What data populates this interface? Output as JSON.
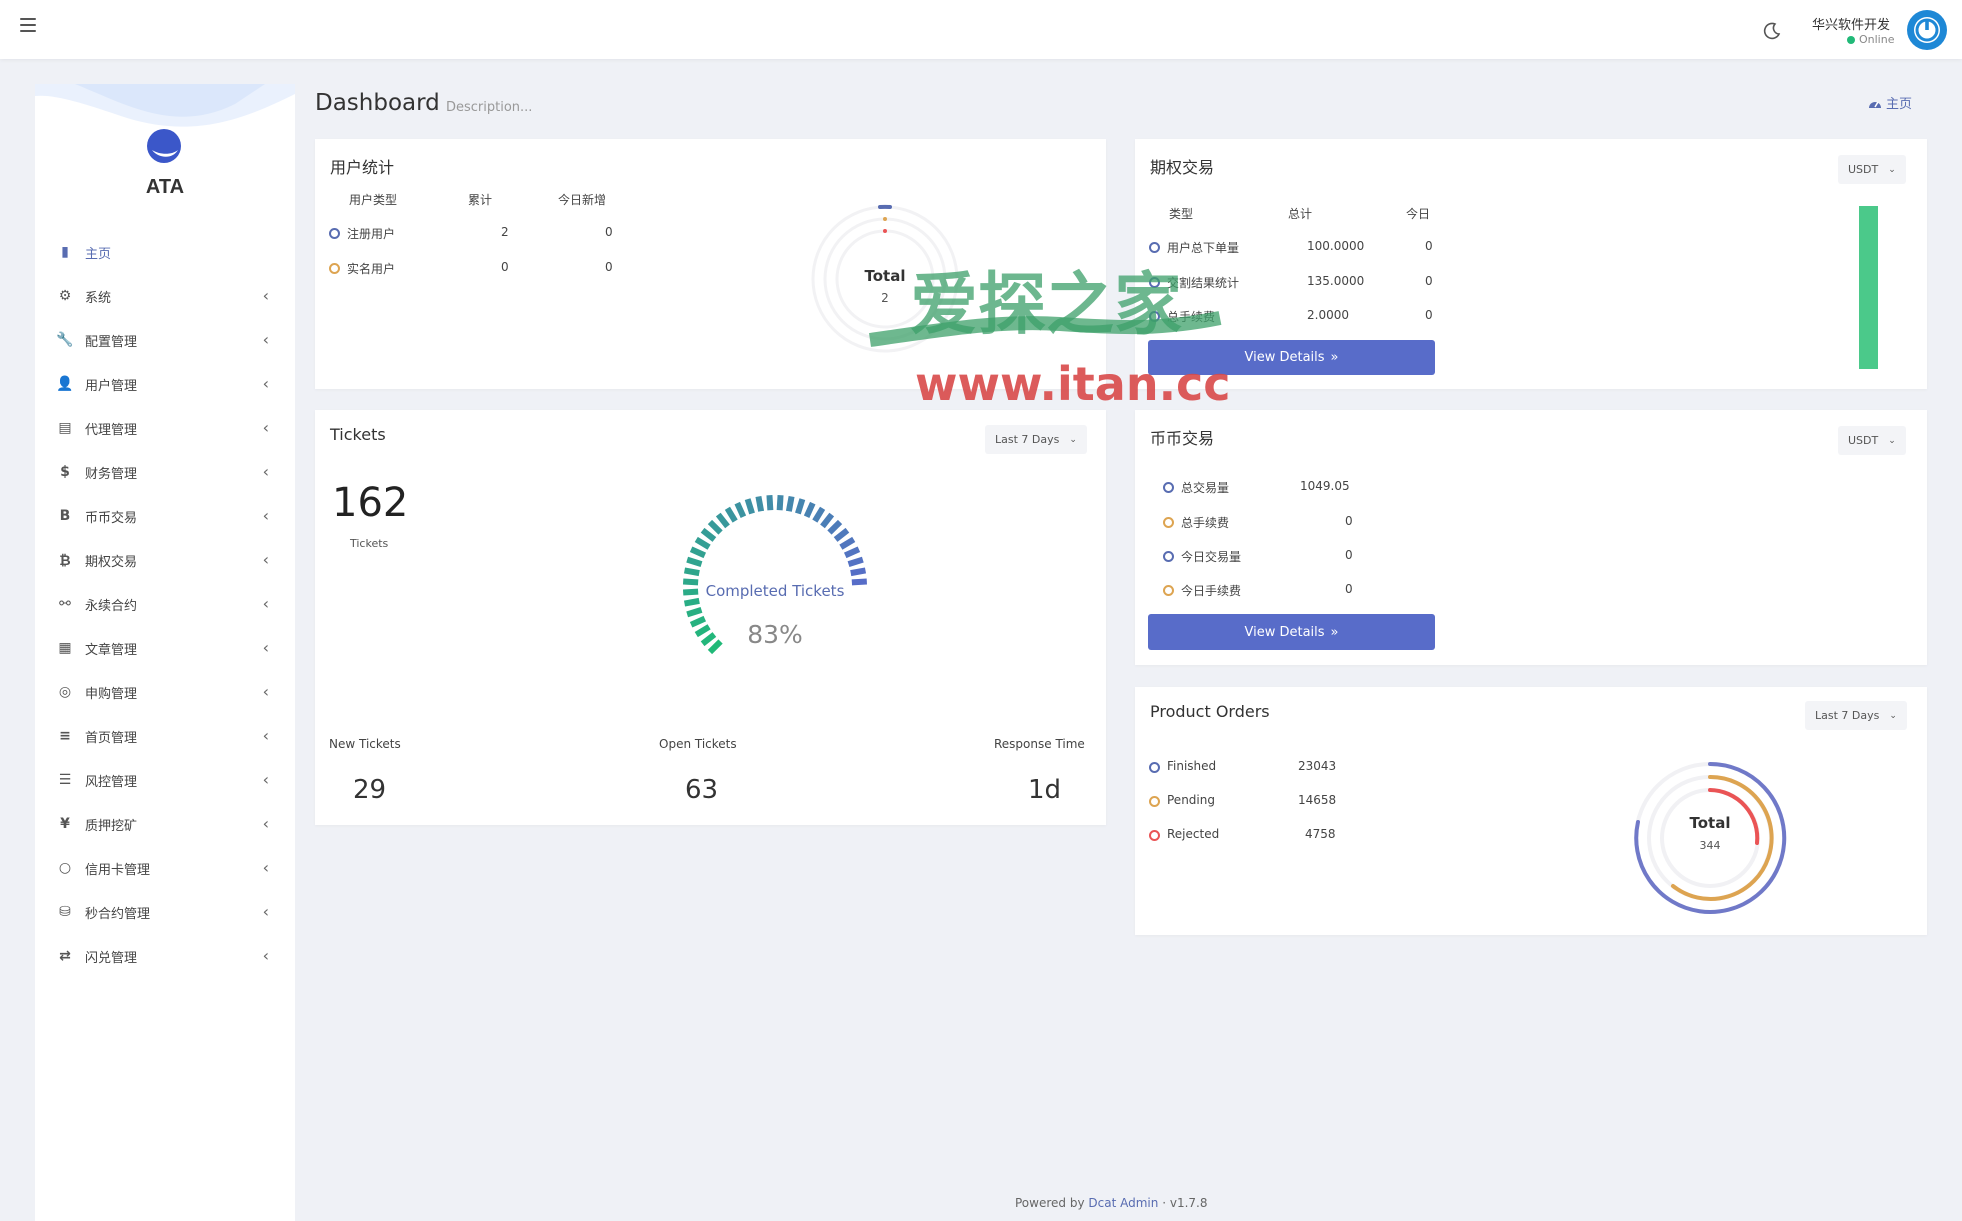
{
  "topbar": {
    "user_name": "华兴软件开发",
    "user_status": "Online"
  },
  "sidebar": {
    "brand": "ATA",
    "items": [
      {
        "label": "主页",
        "icon": "bar-chart-icon",
        "active": true,
        "has_children": false
      },
      {
        "label": "系统",
        "icon": "gear-icon",
        "has_children": true
      },
      {
        "label": "配置管理",
        "icon": "wrench-icon",
        "has_children": true
      },
      {
        "label": "用户管理",
        "icon": "users-icon",
        "has_children": true
      },
      {
        "label": "代理管理",
        "icon": "id-card-icon",
        "has_children": true
      },
      {
        "label": "财务管理",
        "icon": "dollar-icon",
        "has_children": true
      },
      {
        "label": "币币交易",
        "icon": "bitcoin-b-icon",
        "has_children": true
      },
      {
        "label": "期权交易",
        "icon": "bitcoin-icon",
        "has_children": true
      },
      {
        "label": "永续合约",
        "icon": "link-icon",
        "has_children": true
      },
      {
        "label": "文章管理",
        "icon": "newspaper-icon",
        "has_children": true
      },
      {
        "label": "申购管理",
        "icon": "life-ring-icon",
        "has_children": true
      },
      {
        "label": "首页管理",
        "icon": "list-icon",
        "has_children": true
      },
      {
        "label": "风控管理",
        "icon": "list-alt-icon",
        "has_children": true
      },
      {
        "label": "质押挖矿",
        "icon": "yen-icon",
        "has_children": true
      },
      {
        "label": "信用卡管理",
        "icon": "circle-icon",
        "has_children": true
      },
      {
        "label": "秒合约管理",
        "icon": "coins-icon",
        "has_children": true
      },
      {
        "label": "闪兑管理",
        "icon": "exchange-icon",
        "has_children": true
      }
    ]
  },
  "page": {
    "title": "Dashboard",
    "description": "Description...",
    "breadcrumb": "主页"
  },
  "user_stats": {
    "title": "用户统计",
    "headers": [
      "用户类型",
      "累计",
      "今日新增"
    ],
    "rows": [
      {
        "label": "注册用户",
        "total": "2",
        "today": "0",
        "color": "#586cb1"
      },
      {
        "label": "实名用户",
        "total": "0",
        "today": "0",
        "color": "#dda451"
      }
    ],
    "chart_label": "Total",
    "chart_value": "2"
  },
  "options": {
    "title": "期权交易",
    "currency": "USDT",
    "headers": [
      "类型",
      "总计",
      "今日"
    ],
    "rows": [
      {
        "label": "用户总下单量",
        "total": "100.0000",
        "today": "0"
      },
      {
        "label": "交割结果统计",
        "total": "135.0000",
        "today": "0"
      },
      {
        "label": "总手续费",
        "total": "2.0000",
        "today": "0"
      }
    ],
    "button": "View Details",
    "bar_color": "#4bc98a"
  },
  "tickets": {
    "title": "Tickets",
    "range": "Last 7 Days",
    "total": "162",
    "total_label": "Tickets",
    "gauge_label": "Completed Tickets",
    "gauge_value": "83%",
    "completed_percent": 83,
    "stats": [
      {
        "label": "New Tickets",
        "value": "29"
      },
      {
        "label": "Open Tickets",
        "value": "63"
      },
      {
        "label": "Response Time",
        "value": "1d"
      }
    ]
  },
  "coin": {
    "title": "币币交易",
    "currency": "USDT",
    "rows": [
      {
        "label": "总交易量",
        "value": "1049.05",
        "color": "#586cb1"
      },
      {
        "label": "总手续费",
        "value": "0",
        "color": "#dda451"
      },
      {
        "label": "今日交易量",
        "value": "0",
        "color": "#586cb1"
      },
      {
        "label": "今日手续费",
        "value": "0",
        "color": "#dda451"
      }
    ],
    "button": "View Details"
  },
  "orders": {
    "title": "Product Orders",
    "range": "Last 7 Days",
    "rows": [
      {
        "label": "Finished",
        "value": "23043",
        "color": "#586cb1"
      },
      {
        "label": "Pending",
        "value": "14658",
        "color": "#dda451"
      },
      {
        "label": "Rejected",
        "value": "4758",
        "color": "#ea5455"
      }
    ],
    "chart_label": "Total",
    "chart_value": "344"
  },
  "footer": {
    "prefix": "Powered by",
    "link": "Dcat Admin",
    "sep": "·",
    "version": "v1.7.8"
  },
  "watermark": {
    "text_cn": "爱探之家",
    "url": "www.itan.cc"
  }
}
